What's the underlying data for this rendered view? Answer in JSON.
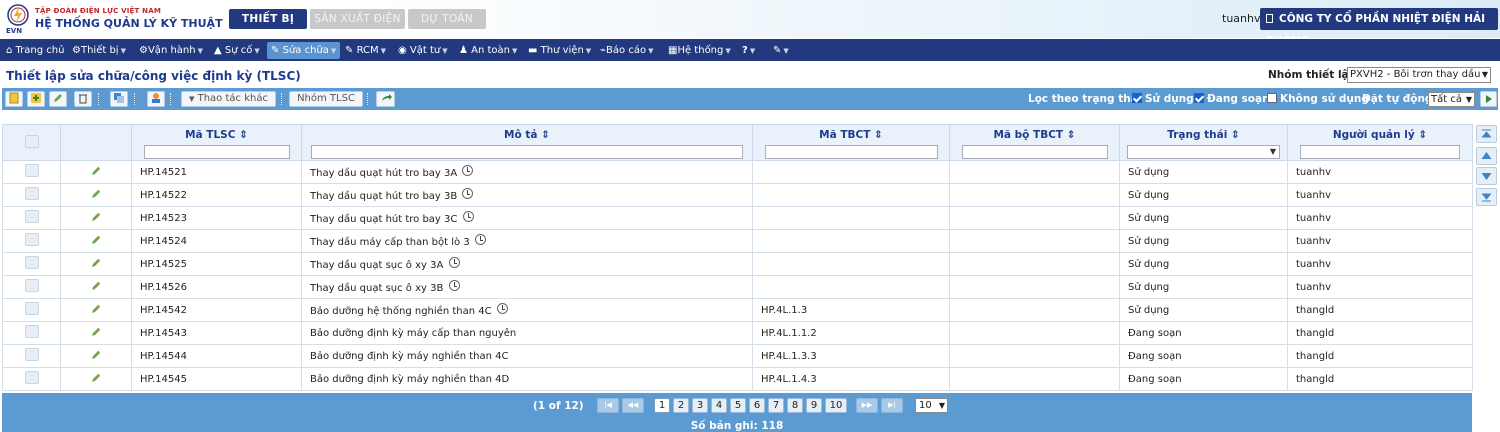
{
  "brand": {
    "company_group": "TẬP ĐOÀN ĐIỆN LỰC VIỆT NAM",
    "system_name": "HỆ THỐNG QUẢN LÝ KỸ THUẬT",
    "logo_text": "EVN"
  },
  "top_tabs": [
    "THIẾT BỊ",
    "SẢN XUẤT ĐIỆN",
    "DỰ TOÁN"
  ],
  "user": "tuanhv",
  "company": "CÔNG TY CỔ PHẦN NHIỆT ĐIỆN HẢI PHÒNG",
  "menu": [
    "Trang chủ",
    "Thiết bị",
    "Vận hành",
    "Sự cố",
    "Sửa chữa",
    "RCM",
    "Vật tư",
    "An toàn",
    "Thư viện",
    "Báo cáo",
    "Hệ thống",
    "?"
  ],
  "page_title": "Thiết lập sửa chữa/công việc định kỳ (TLSC)",
  "group_label": "Nhóm thiết lập",
  "group_value": "PXVH2 - Bôi trơn thay dầu",
  "toolbar": {
    "actions_label": "Thao tác khác",
    "group_button": "Nhóm TLSC"
  },
  "filter": {
    "label": "Lọc theo trạng thái",
    "options": [
      "Sử dụng",
      "Đang soạn",
      "Không sử dụng"
    ],
    "auto_label": "Đặt tự động",
    "auto_value": "Tất cả"
  },
  "columns": [
    "Mã TLSC",
    "Mô tả",
    "Mã TBCT",
    "Mã bộ TBCT",
    "Trạng thái",
    "Người quản lý"
  ],
  "rows": [
    {
      "code": "HP.14521",
      "desc": "Thay dầu quạt hút tro bay 3A",
      "clock": true,
      "tbct": "",
      "bo": "",
      "status": "Sử dụng",
      "owner": "tuanhv"
    },
    {
      "code": "HP.14522",
      "desc": "Thay dầu quạt hút tro bay 3B",
      "clock": true,
      "tbct": "",
      "bo": "",
      "status": "Sử dụng",
      "owner": "tuanhv"
    },
    {
      "code": "HP.14523",
      "desc": "Thay dầu quạt hút tro bay 3C",
      "clock": true,
      "tbct": "",
      "bo": "",
      "status": "Sử dụng",
      "owner": "tuanhv"
    },
    {
      "code": "HP.14524",
      "desc": "Thay dầu máy cấp than bột lò 3",
      "clock": true,
      "tbct": "",
      "bo": "",
      "status": "Sử dụng",
      "owner": "tuanhv"
    },
    {
      "code": "HP.14525",
      "desc": "Thay dầu quạt sục ô xy 3A",
      "clock": true,
      "tbct": "",
      "bo": "",
      "status": "Sử dụng",
      "owner": "tuanhv"
    },
    {
      "code": "HP.14526",
      "desc": "Thay dầu quạt sục ô xy 3B",
      "clock": true,
      "tbct": "",
      "bo": "",
      "status": "Sử dụng",
      "owner": "tuanhv"
    },
    {
      "code": "HP.14542",
      "desc": "Bảo dưỡng hệ thống nghiền than 4C",
      "clock": true,
      "tbct": "HP.4L.1.3",
      "bo": "",
      "status": "Sử dụng",
      "owner": "thangld"
    },
    {
      "code": "HP.14543",
      "desc": "Bảo dưỡng định kỳ máy cấp than nguyên",
      "clock": false,
      "tbct": "HP.4L.1.1.2",
      "bo": "",
      "status": "Đang soạn",
      "owner": "thangld"
    },
    {
      "code": "HP.14544",
      "desc": "Bảo dưỡng định kỳ máy nghiền than 4C",
      "clock": false,
      "tbct": "HP.4L.1.3.3",
      "bo": "",
      "status": "Đang soạn",
      "owner": "thangld"
    },
    {
      "code": "HP.14545",
      "desc": "Bảo dưỡng định kỳ máy nghiền than 4D",
      "clock": false,
      "tbct": "HP.4L.1.4.3",
      "bo": "",
      "status": "Đang soạn",
      "owner": "thangld"
    }
  ],
  "pager": {
    "info": "(1 of 12)",
    "pages": [
      "1",
      "2",
      "3",
      "4",
      "5",
      "6",
      "7",
      "8",
      "9",
      "10"
    ],
    "current": "1",
    "page_size": "10",
    "count": "Số bản ghi: 118"
  },
  "colors": {
    "navy": "#22397f",
    "toolbar": "#5c9bd1",
    "header_bg": "#e9f2fa"
  }
}
